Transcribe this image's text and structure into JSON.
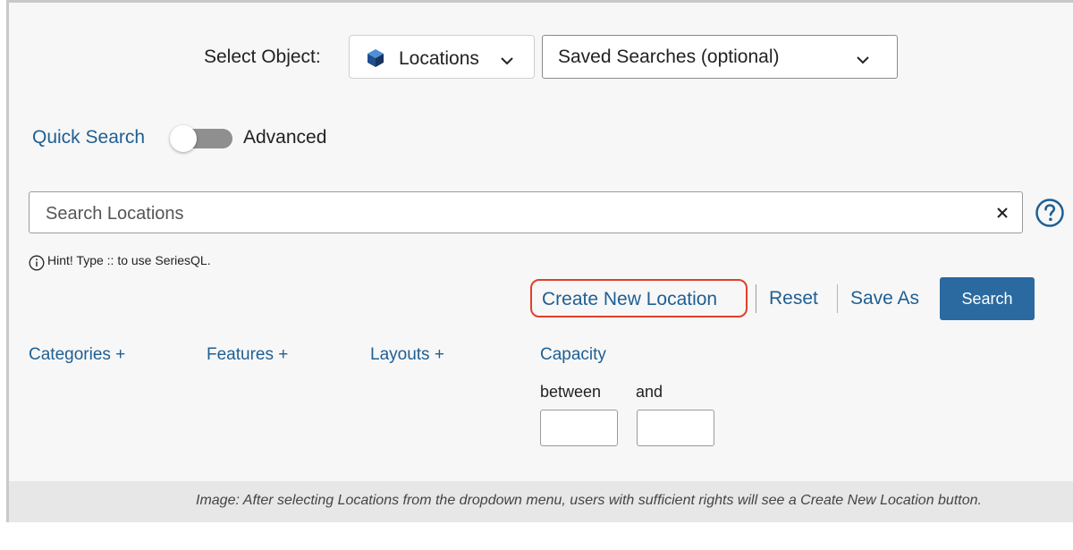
{
  "header": {
    "select_object_label": "Select Object:",
    "object_selected": "Locations",
    "saved_searches_selected": "Saved Searches (optional)"
  },
  "mode": {
    "quick_label": "Quick Search",
    "advanced_label": "Advanced",
    "toggle_state": "quick"
  },
  "search": {
    "placeholder": "Search Locations",
    "hint": "Hint! Type :: to use SeriesQL."
  },
  "actions": {
    "create_new": "Create New Location",
    "reset": "Reset",
    "save_as": "Save As",
    "search": "Search"
  },
  "facets": {
    "categories": "Categories +",
    "features": "Features +",
    "layouts": "Layouts +",
    "capacity": "Capacity",
    "between": "between",
    "and": "and"
  },
  "caption": "Image: After selecting Locations from the dropdown menu, users with sufficient rights will see a Create New Location button.",
  "colors": {
    "link": "#1f5f93",
    "primary_button": "#2a6aa0",
    "highlight": "#e43e2b",
    "panel_bg": "#f7f7f7"
  },
  "icons": {
    "object_icon": "cube-icon",
    "dropdown": "chevron-down-icon",
    "clear": "close-icon",
    "help": "help-circle-icon",
    "hint": "info-icon"
  }
}
